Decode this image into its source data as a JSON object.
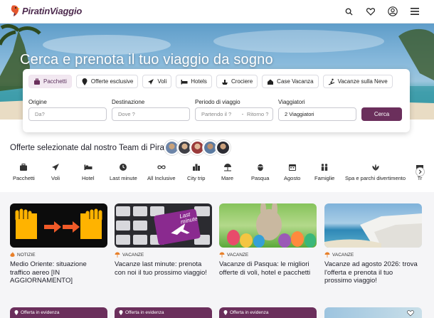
{
  "header": {
    "logo_text": "PiratinViaggio",
    "icons": [
      "search-icon",
      "heart-icon",
      "user-icon",
      "menu-icon"
    ]
  },
  "hero": {
    "title": "Cerca e prenota il tuo viaggio da sogno"
  },
  "search": {
    "tabs": [
      {
        "label": "Pacchetti",
        "icon": "package-icon",
        "active": true
      },
      {
        "label": "Offerte esclusive",
        "icon": "pin-icon",
        "active": false
      },
      {
        "label": "Voli",
        "icon": "plane-icon",
        "active": false
      },
      {
        "label": "Hotels",
        "icon": "bed-icon",
        "active": false
      },
      {
        "label": "Crociere",
        "icon": "ship-icon",
        "active": false
      },
      {
        "label": "Case Vacanza",
        "icon": "house-icon",
        "active": false
      },
      {
        "label": "Vacanze sulla Neve",
        "icon": "ski-icon",
        "active": false
      }
    ],
    "origin_label": "Origine",
    "origin_placeholder": "Da?",
    "destination_label": "Destinazione",
    "destination_placeholder": "Dove ?",
    "period_label": "Periodo di viaggio",
    "depart_placeholder": "Partendo il ?",
    "return_placeholder": "Ritorno ?",
    "period_separator": "-",
    "travelers_label": "Viaggiatori",
    "travelers_value": "2 Viaggiatori",
    "search_button": "Cerca",
    "accent_color": "#6b2f5c"
  },
  "team": {
    "title": "Offerte selezionate dal nostro Team di Pirati"
  },
  "categories": [
    {
      "label": "Pacchetti",
      "icon": "suitcase-icon"
    },
    {
      "label": "Voli",
      "icon": "plane-icon"
    },
    {
      "label": "Hotel",
      "icon": "bed-icon"
    },
    {
      "label": "Last minute",
      "icon": "clock-icon"
    },
    {
      "label": "All Inclusive",
      "icon": "infinity-icon"
    },
    {
      "label": "City trip",
      "icon": "city-icon"
    },
    {
      "label": "Mare",
      "icon": "umbrella-icon"
    },
    {
      "label": "Pasqua",
      "icon": "egg-icon"
    },
    {
      "label": "Agosto",
      "icon": "calendar-icon"
    },
    {
      "label": "Famiglie",
      "icon": "family-icon"
    },
    {
      "label": "Spa e parchi divertimento",
      "icon": "spa-icon"
    },
    {
      "label": "Tr",
      "icon": "more-icon"
    }
  ],
  "articles": [
    {
      "tag": "NOTIZIE",
      "title": "Medio Oriente: situazione traffico aereo [IN AGGIORNAMENTO]",
      "image": "hands-arrows-image"
    },
    {
      "tag": "VACANZE",
      "title": "Vacanze last minute: prenota con noi il tuo prossimo viaggio!",
      "image": "keyboard-image"
    },
    {
      "tag": "VACANZE",
      "title": "Vacanze di Pasqua: le migliori offerte di voli, hotel e pacchetti",
      "image": "easter-bunny-image"
    },
    {
      "tag": "VACANZE",
      "title": "Vacanze ad agosto 2026: trova l'offerta e prenota il tuo prossimo viaggio!",
      "image": "beach-cliff-image"
    }
  ],
  "featured": [
    {
      "label": "Offerta in evidenza"
    },
    {
      "label": "Offerta in evidenza"
    },
    {
      "label": "Offerta in evidenza"
    }
  ],
  "keyboard_key_text": "Last minute"
}
